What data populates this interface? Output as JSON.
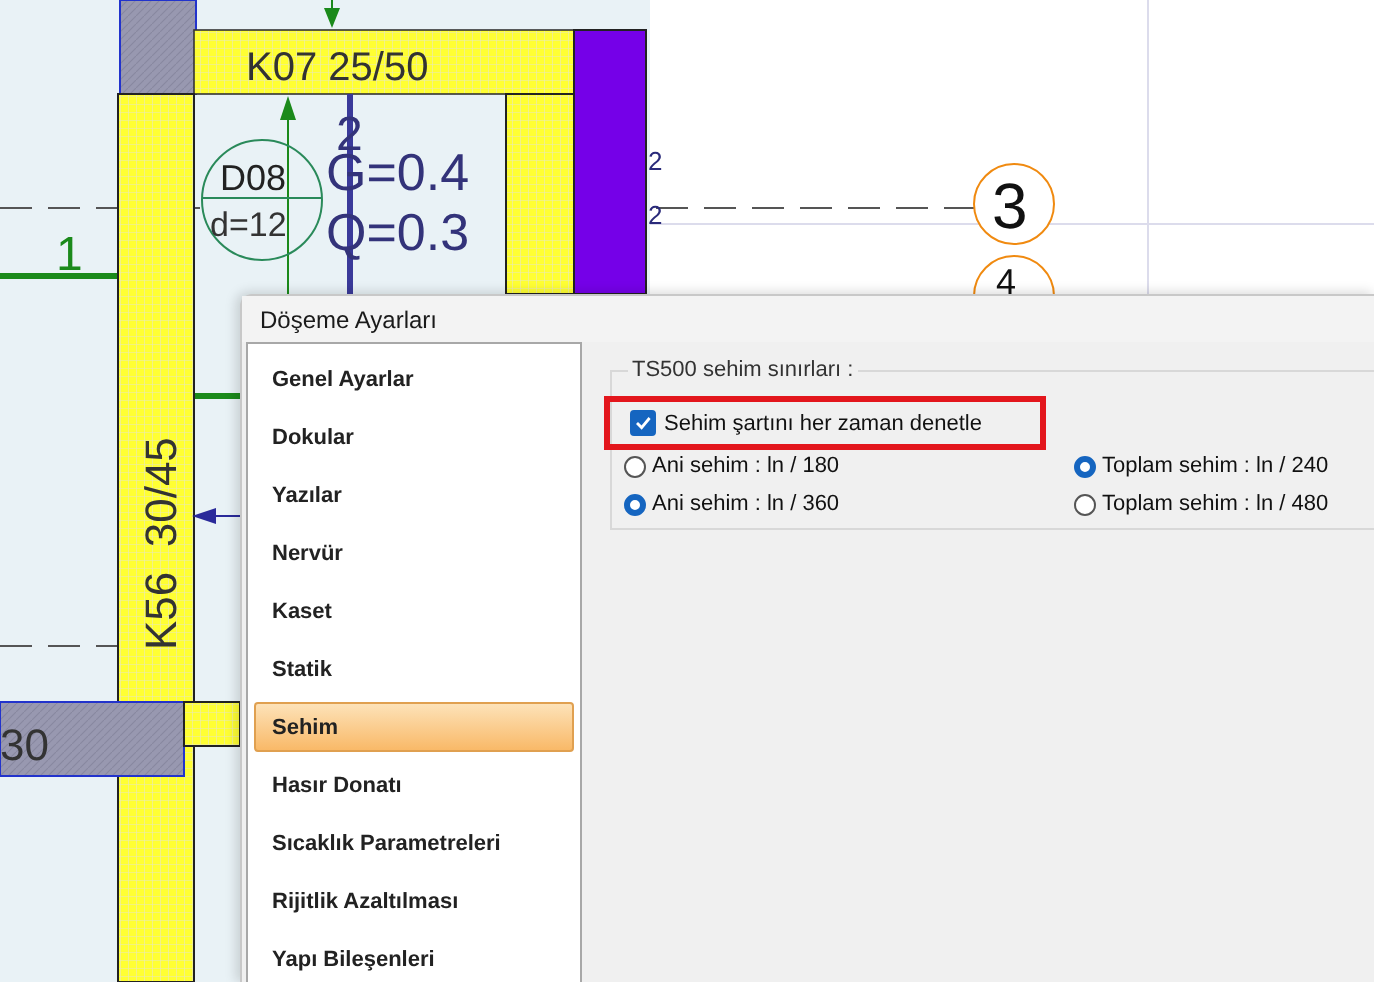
{
  "drawing": {
    "beam_label": "K07 25/50",
    "column_label": "K56  30/45",
    "slab_name": "D08",
    "slab_thickness": "d=12",
    "slab_number": "2",
    "dead_load": "G=0.4",
    "live_load": "Q=0.3",
    "axis_label": "1",
    "side_marks": [
      "2",
      "2"
    ],
    "beam_stub_label": "30",
    "axis_bubbles": [
      "3",
      "4"
    ]
  },
  "dialog": {
    "title": "Döşeme Ayarları",
    "nav": [
      {
        "label": "Genel Ayarlar",
        "selected": false
      },
      {
        "label": "Dokular",
        "selected": false
      },
      {
        "label": "Yazılar",
        "selected": false
      },
      {
        "label": "Nervür",
        "selected": false
      },
      {
        "label": "Kaset",
        "selected": false
      },
      {
        "label": "Statik",
        "selected": false
      },
      {
        "label": "Sehim",
        "selected": true
      },
      {
        "label": "Hasır Donatı",
        "selected": false
      },
      {
        "label": "Sıcaklık Parametreleri",
        "selected": false
      },
      {
        "label": "Rijitlik Azaltılması",
        "selected": false
      },
      {
        "label": "Yapı Bileşenleri",
        "selected": false
      }
    ],
    "group": {
      "title": "TS500 sehim sınırları :",
      "checkbox": {
        "label": "Sehim şartını her zaman denetle",
        "checked": true,
        "highlighted": true
      },
      "radios": [
        {
          "label": "Ani sehim : ln / 180",
          "selected": false
        },
        {
          "label": "Toplam sehim  : ln / 240",
          "selected": true
        },
        {
          "label": "Ani sehim : ln / 360",
          "selected": true
        },
        {
          "label": "Toplam sehim : ln / 480",
          "selected": false
        }
      ]
    }
  }
}
